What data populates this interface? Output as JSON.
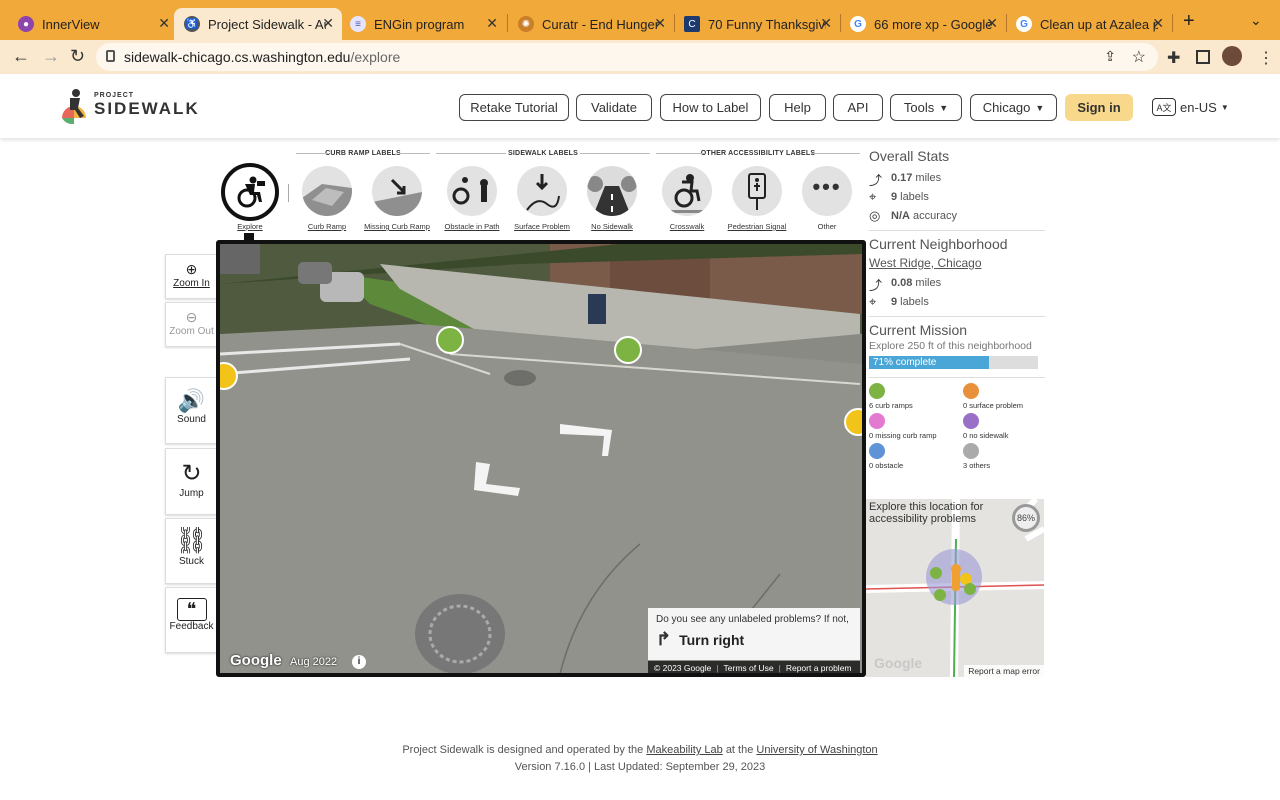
{
  "browser": {
    "tabs": [
      {
        "title": "InnerView"
      },
      {
        "title": "Project Sidewalk - Au"
      },
      {
        "title": "ENGin program"
      },
      {
        "title": "Curatr - End Hunger"
      },
      {
        "title": "70 Funny Thanksgivin"
      },
      {
        "title": "66 more xp - Google"
      },
      {
        "title": "Clean up at Azalea pa"
      }
    ],
    "url_host": "sidewalk-chicago.cs.washington.edu",
    "url_path": "/explore"
  },
  "header": {
    "logo_small": "PROJECT",
    "logo_big": "SIDEWALK",
    "nav": [
      "Retake Tutorial",
      "Validate",
      "How to Label",
      "Help",
      "API",
      "Tools",
      "Chicago"
    ],
    "signin": "Sign in",
    "lang": "en-US"
  },
  "toolbar": {
    "group_curb": "CURB RAMP LABELS",
    "group_sidewalk": "SIDEWALK LABELS",
    "group_other": "OTHER ACCESSIBILITY LABELS",
    "explore": "Explore",
    "labels": [
      "Curb Ramp",
      "Missing Curb Ramp",
      "Obstacle in Path",
      "Surface Problem",
      "No Sidewalk",
      "Crosswalk",
      "Pedestrian Signal",
      "Other"
    ]
  },
  "side": {
    "zoom_in": "Zoom In",
    "zoom_out": "Zoom Out",
    "sound": "Sound",
    "jump": "Jump",
    "stuck": "Stuck",
    "feedback": "Feedback"
  },
  "pano": {
    "google": "Google",
    "date": "Aug 2022",
    "prompt": "Do you see any unlabeled problems? If not,",
    "turn": "Turn right",
    "copyright": "© 2023 Google",
    "terms": "Terms of Use",
    "report": "Report a problem"
  },
  "stats": {
    "overall_title": "Overall Stats",
    "overall_miles": "0.17",
    "miles_unit": "miles",
    "overall_labels": "9",
    "labels_unit": "labels",
    "accuracy": "N/A",
    "accuracy_unit": "accuracy",
    "neighborhood_title": "Current Neighborhood",
    "neighborhood": "West Ridge, Chicago",
    "nb_miles": "0.08",
    "nb_labels": "9",
    "mission_title": "Current Mission",
    "mission_text": "Explore 250 ft of this neighborhood",
    "mission_progress": 0.71,
    "mission_progress_label": "71% complete",
    "counts": {
      "curb": "6 curb ramps",
      "surface": "0 surface problem",
      "missing": "0 missing curb ramp",
      "nosidewalk": "0 no sidewalk",
      "obstacle": "0 obstacle",
      "others": "3 others"
    }
  },
  "minimap": {
    "text": "Explore this location for accessibility problems",
    "percent": "86%",
    "google": "Google",
    "report": "Report a map error"
  },
  "footer": {
    "pre": "Project Sidewalk is designed and operated by the",
    "lab": "Makeability Lab",
    "mid": "at the",
    "uni": "University of Washington",
    "version": "Version 7.16.0 | Last Updated: September 29, 2023"
  }
}
